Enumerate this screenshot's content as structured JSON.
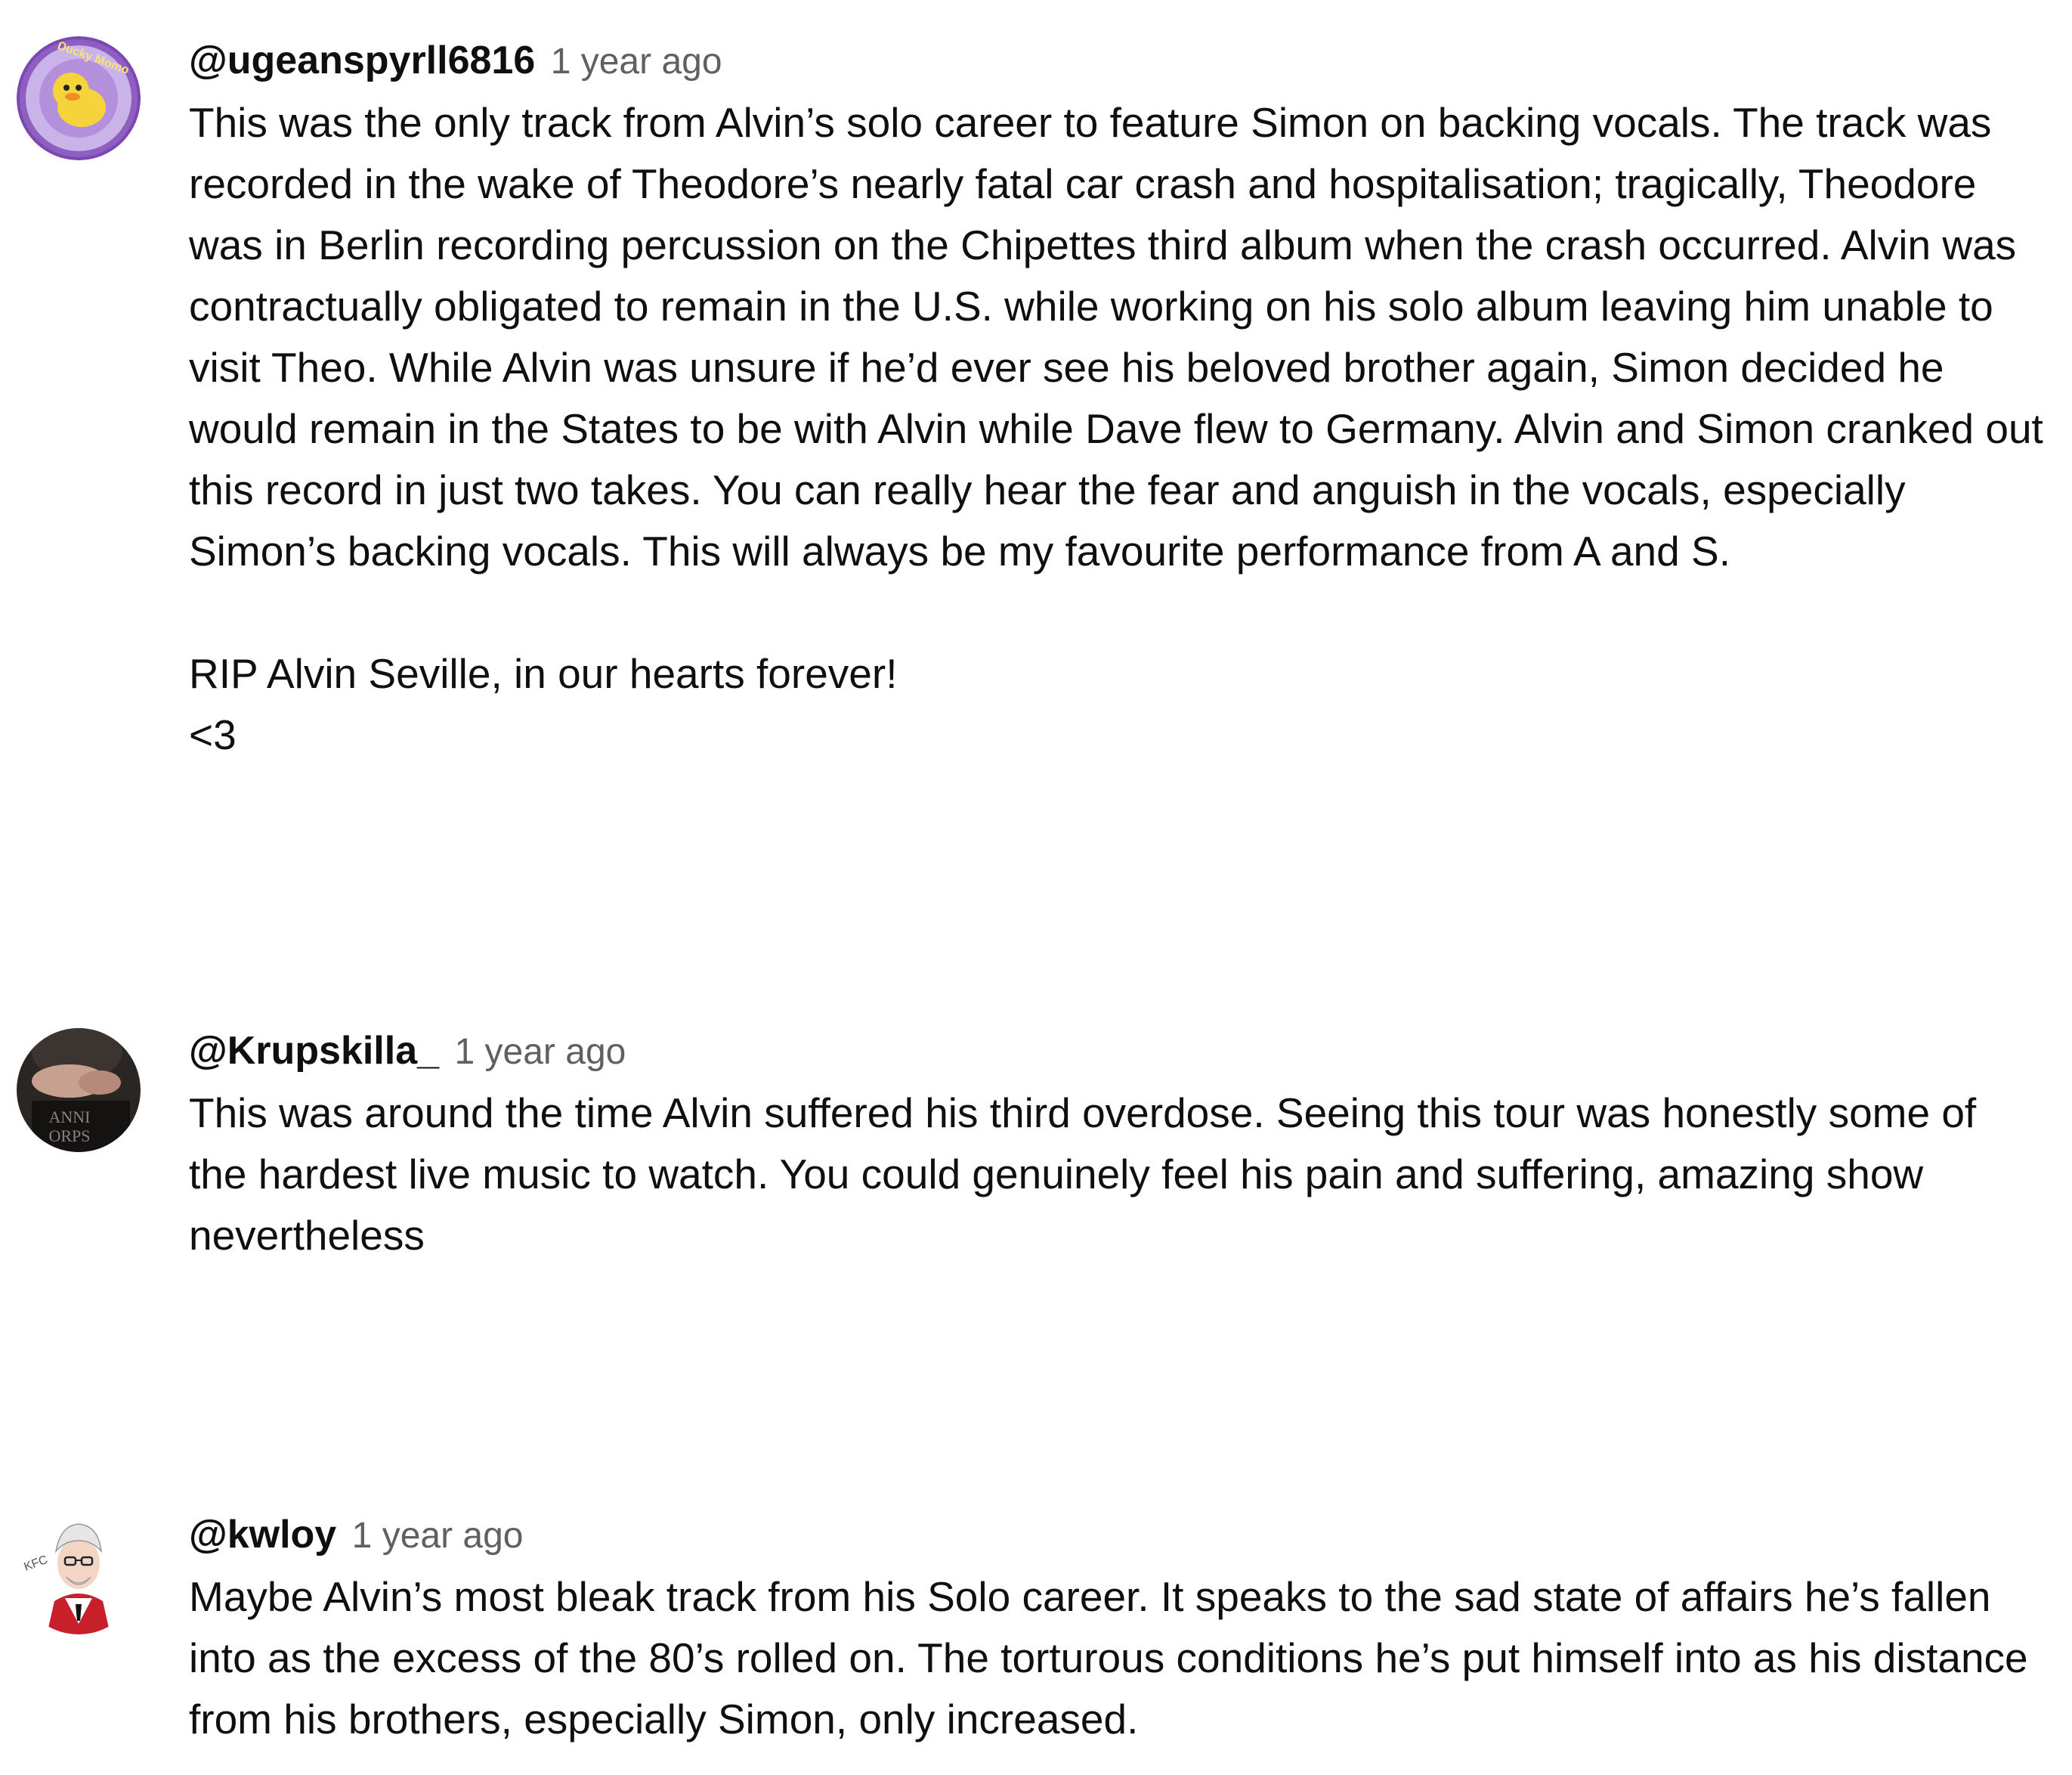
{
  "comments": [
    {
      "author": "@ugeanspyrll6816",
      "timestamp": "1 year ago",
      "avatar_icon": "ducky-momo-avatar-icon",
      "avatar_text": "Ducky Momo",
      "paragraphs": [
        "This was the only track from Alvin’s solo career to feature Simon on backing vocals. The track was recorded in the wake of Theodore’s nearly fatal car crash and hospitalisation; tragically, Theodore was in Berlin recording percussion on the Chipettes third album when the crash occurred. Alvin was contractually obligated to remain in the U.S. while working on his solo album leaving him unable to visit Theo. While Alvin was unsure if he’d ever see his beloved brother again, Simon decided he would remain in the States to be with Alvin while Dave flew to Germany. Alvin and Simon cranked out this record in just two takes. You can really hear the fear and anguish in the vocals, especially Simon’s backing vocals. This will always be my favourite performance from A and S.",
        "RIP Alvin Seville, in our hearts forever!",
        "<3"
      ]
    },
    {
      "author": "@Krupskilla_",
      "timestamp": "1 year ago",
      "avatar_icon": "band-shirt-avatar-icon",
      "paragraphs": [
        "This was around the time Alvin suffered his third overdose. Seeing this tour was honestly some of the hardest live music to watch. You could genuinely feel his pain and suffering, amazing show nevertheless"
      ]
    },
    {
      "author": "@kwloy",
      "timestamp": "1 year ago",
      "avatar_icon": "colonel-cartoon-avatar-icon",
      "paragraphs": [
        "Maybe Alvin’s most bleak track from his Solo career. It speaks to the sad state of affairs he’s fallen into as the excess of the 80’s rolled on. The torturous conditions he’s put himself into as his distance from his brothers, especially Simon, only increased."
      ]
    }
  ],
  "colors": {
    "author": "#0f0f0f",
    "timestamp": "#606060",
    "text": "#0f0f0f",
    "avatar1_ring": "#8e5fc0",
    "avatar1_fill": "#f5d33a"
  }
}
